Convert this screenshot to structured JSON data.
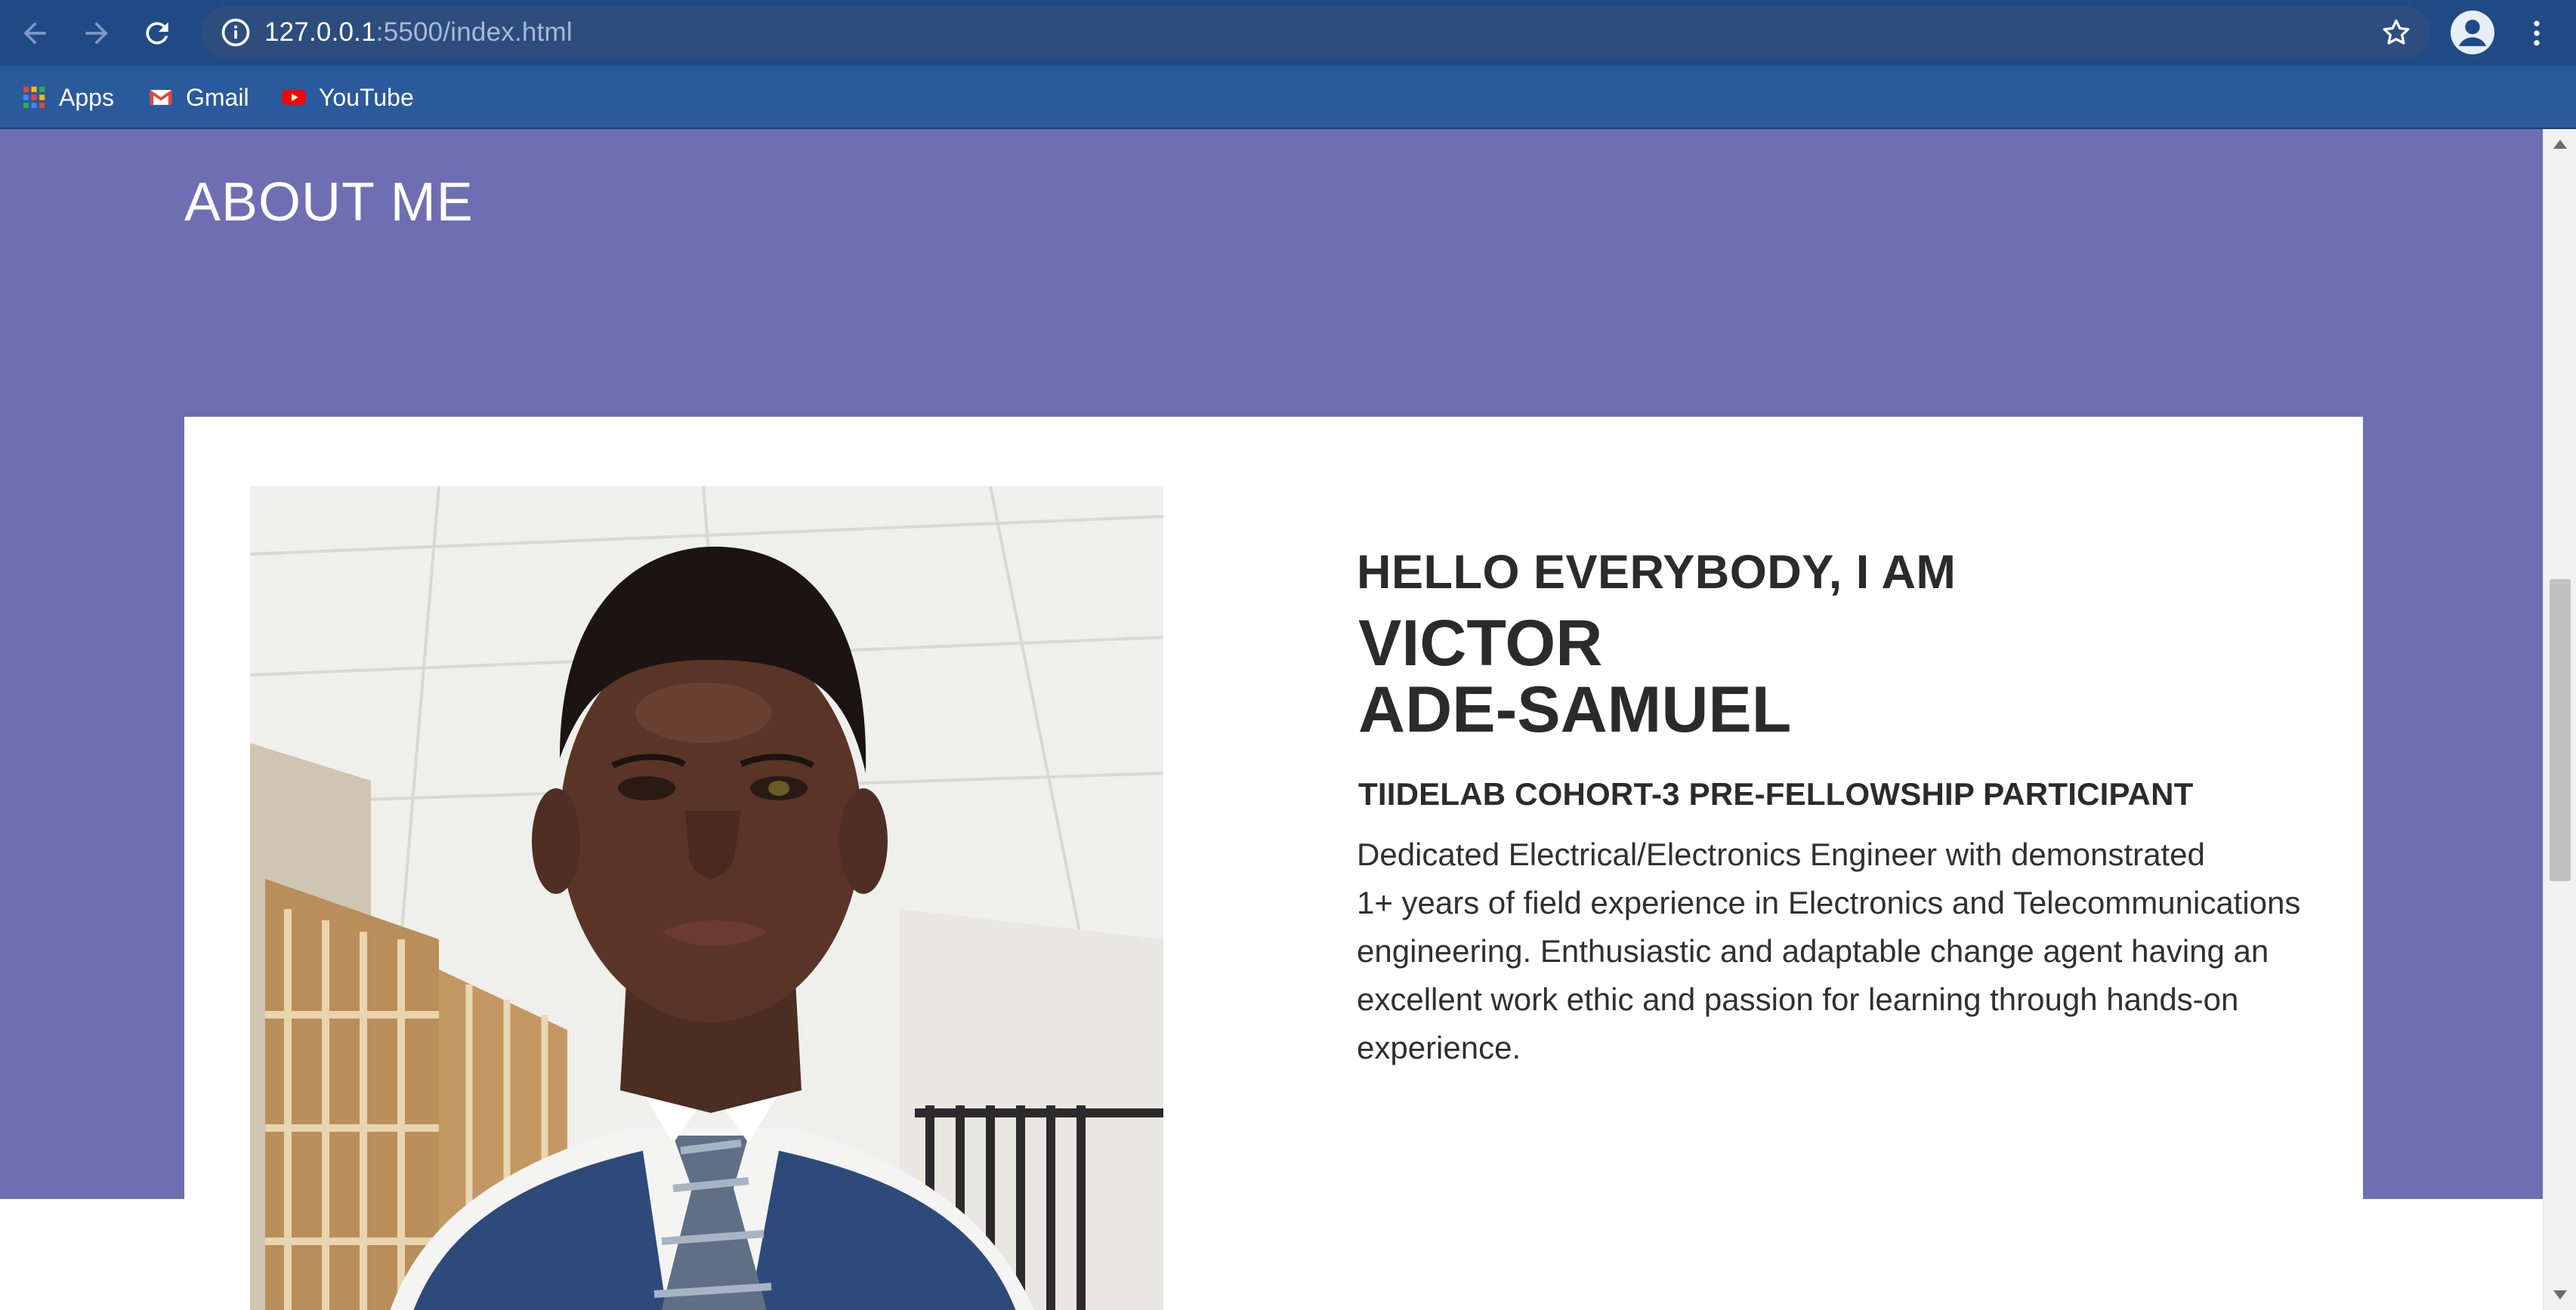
{
  "browser": {
    "url_host": "127.0.0.1",
    "url_path": ":5500/index.html",
    "bookmarks": [
      {
        "label": "Apps",
        "icon": "apps-grid-icon"
      },
      {
        "label": "Gmail",
        "icon": "gmail-icon"
      },
      {
        "label": "YouTube",
        "icon": "youtube-icon"
      }
    ]
  },
  "about": {
    "section_title": "ABOUT ME",
    "greeting": "HELLO EVERYBODY, I AM",
    "first_name": "VICTOR",
    "last_name": "ADE-SAMUEL",
    "role": "TIIDELAB COHORT-3 PRE-FELLOWSHIP PARTICIPANT",
    "bio_lines": [
      "Dedicated Electrical/Electronics Engineer with demonstrated",
      "1+ years of field experience in Electronics and Telecommunications",
      "engineering. Enthusiastic and adaptable change agent having an",
      "excellent work ethic and passion for learning through hands-on",
      "experience."
    ]
  },
  "colors": {
    "chrome_toolbar": "#1f4a86",
    "bookmarks_bar": "#2b5a9c",
    "about_band": "#6e6fb2",
    "card": "#ffffff",
    "text": "#2b2b2b"
  },
  "icons": {
    "back": "arrow-left-icon",
    "forward": "arrow-right-icon",
    "reload": "reload-icon",
    "info": "info-icon",
    "bookmark_star": "star-icon",
    "profile": "account-icon",
    "menu": "kebab-menu-icon"
  }
}
